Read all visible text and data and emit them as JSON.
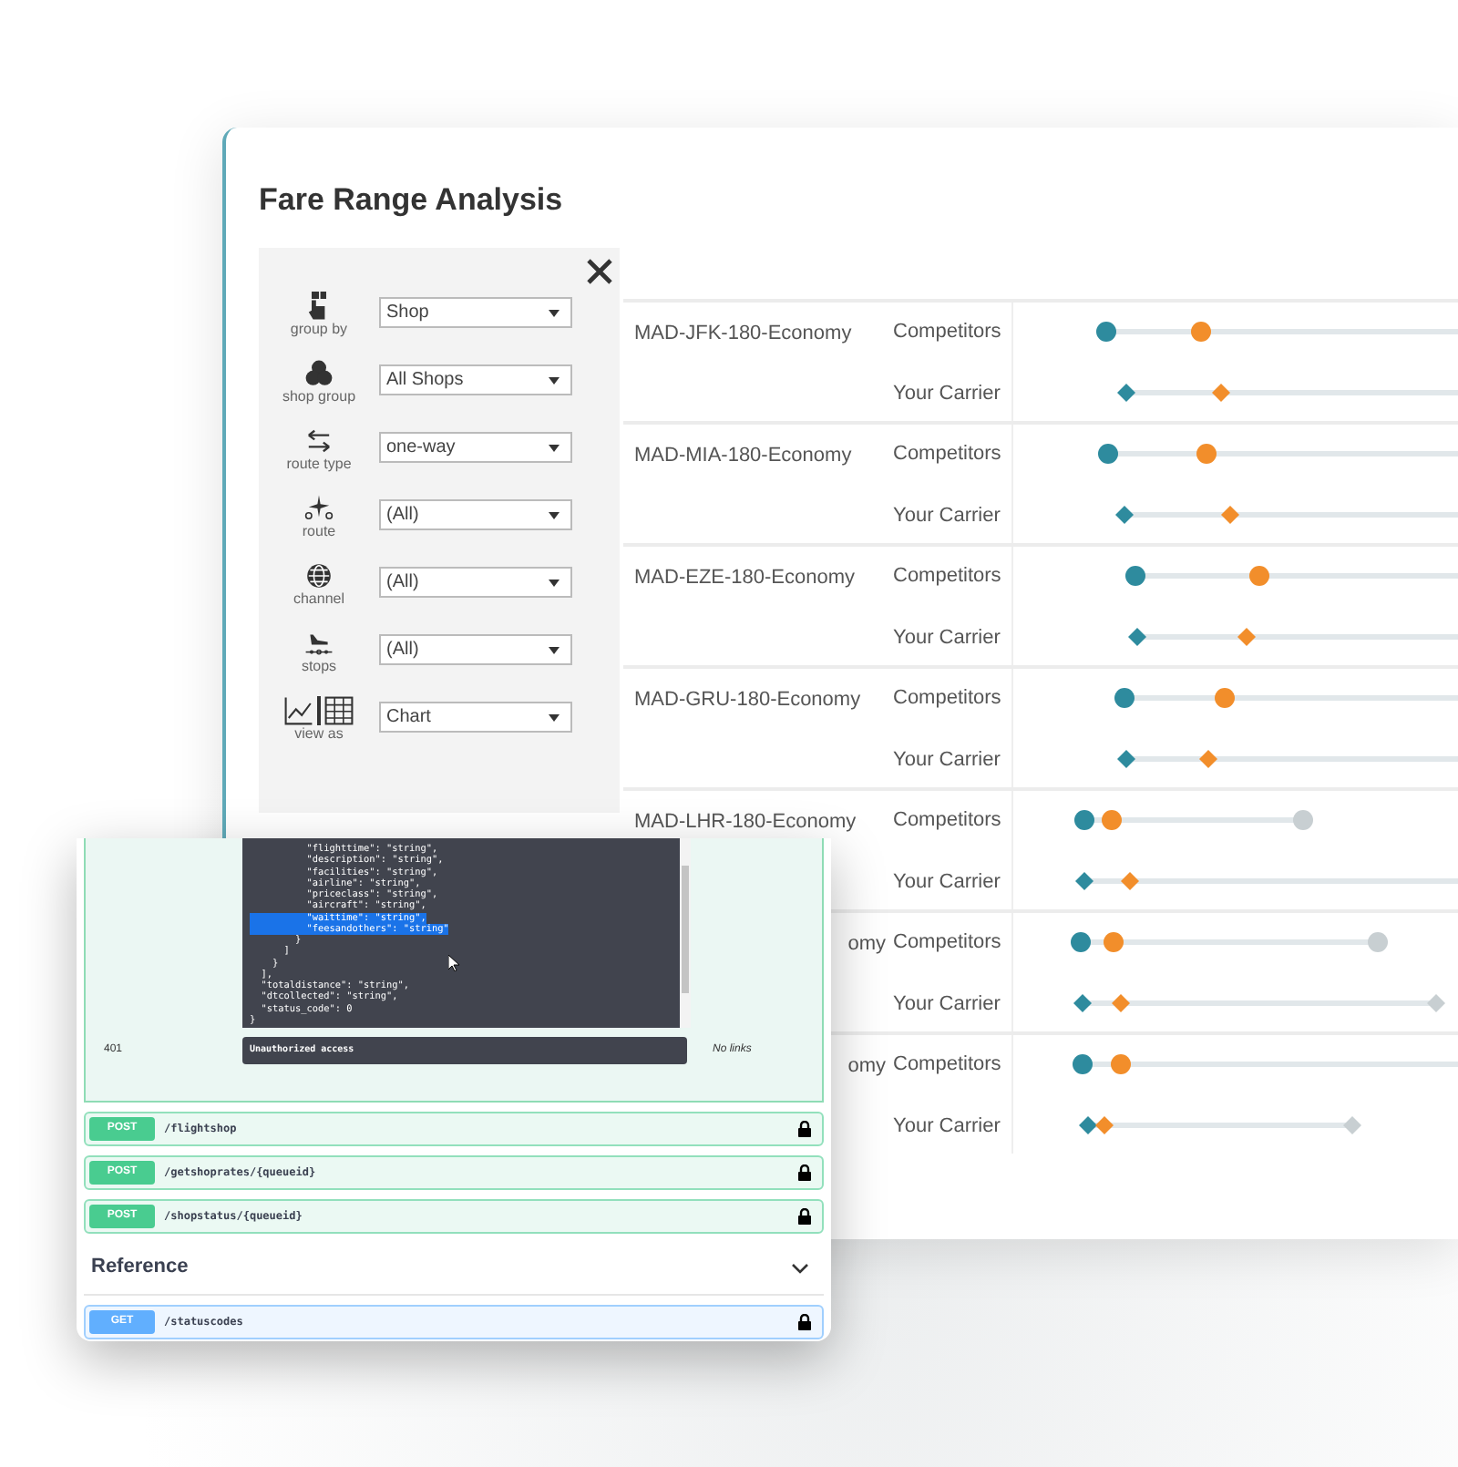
{
  "title": "Fare Range Analysis",
  "filters": [
    {
      "kind": "group",
      "label": "group by",
      "value": "Shop"
    },
    {
      "kind": "shop_group",
      "label": "shop group",
      "value": "All Shops"
    },
    {
      "kind": "route_type",
      "label": "route type",
      "value": "one-way"
    },
    {
      "kind": "route",
      "label": "route",
      "value": "(All)"
    },
    {
      "kind": "channel",
      "label": "channel",
      "value": "(All)"
    },
    {
      "kind": "stops",
      "label": "stops",
      "value": "(All)"
    },
    {
      "kind": "view",
      "label": "view as",
      "value": "Chart"
    }
  ],
  "routes": [
    {
      "label": "MAD-JFK-180-Economy",
      "cut": false,
      "series": [
        {
          "kind": "circle",
          "name": "Competitors"
        },
        {
          "kind": "diamond",
          "name": "Your Carrier"
        }
      ]
    },
    {
      "label": "MAD-MIA-180-Economy",
      "cut": false,
      "series": [
        {
          "kind": "circle",
          "name": "Competitors"
        },
        {
          "kind": "diamond",
          "name": "Your Carrier"
        }
      ]
    },
    {
      "label": "MAD-EZE-180-Economy",
      "cut": false,
      "series": [
        {
          "kind": "circle",
          "name": "Competitors"
        },
        {
          "kind": "diamond",
          "name": "Your Carrier"
        }
      ]
    },
    {
      "label": "MAD-GRU-180-Economy",
      "cut": false,
      "series": [
        {
          "kind": "circle",
          "name": "Competitors"
        },
        {
          "kind": "diamond",
          "name": "Your Carrier"
        }
      ]
    },
    {
      "label": "MAD-LHR-180-Economy",
      "cut": false,
      "series": [
        {
          "kind": "circle",
          "name": "Competitors"
        },
        {
          "kind": "diamond",
          "name": "Your Carrier"
        }
      ]
    },
    {
      "label": "omy",
      "cut": true,
      "series": [
        {
          "kind": "circle",
          "name": "Competitors"
        },
        {
          "kind": "diamond",
          "name": "Your Carrier"
        }
      ]
    },
    {
      "label": "omy",
      "cut": true,
      "series": [
        {
          "kind": "circle",
          "name": "Competitors"
        },
        {
          "kind": "diamond",
          "name": "Your Carrier"
        }
      ]
    }
  ],
  "api_panel": {
    "code_lines": [
      {
        "text": "          \"flighttime\": \"string\",",
        "selected": false
      },
      {
        "text": "          \"description\": \"string\",",
        "selected": false
      },
      {
        "text": "          \"facilities\": \"string\",",
        "selected": false
      },
      {
        "text": "          \"airline\": \"string\",",
        "selected": false
      },
      {
        "text": "          \"priceclass\": \"string\",",
        "selected": false
      },
      {
        "text": "          \"aircraft\": \"string\",",
        "selected": false
      },
      {
        "text": "          \"waittime\": \"string\",",
        "selected": true
      },
      {
        "text": "          \"feesandothers\": \"string\"",
        "selected": true
      },
      {
        "text": "        }",
        "selected": false
      },
      {
        "text": "      ]",
        "selected": false
      },
      {
        "text": "    }",
        "selected": false
      },
      {
        "text": "  ],",
        "selected": false
      },
      {
        "text": "  \"totaldistance\": \"string\",",
        "selected": false
      },
      {
        "text": "  \"dtcollected\": \"string\",",
        "selected": false
      },
      {
        "text": "  \"status_code\": 0",
        "selected": false
      },
      {
        "text": "}",
        "selected": false
      }
    ],
    "status": "401",
    "message": "Unauthorized access",
    "links": "No links",
    "endpoints": [
      {
        "method": "POST",
        "path": "/flightshop",
        "color": "#49cc90"
      },
      {
        "method": "POST",
        "path": "/getshoprates/{queueid}",
        "color": "#49cc90"
      },
      {
        "method": "POST",
        "path": "/shopstatus/{queueid}",
        "color": "#49cc90"
      }
    ],
    "section": {
      "title": "Reference",
      "expanded": true
    },
    "reference_endpoints": [
      {
        "method": "GET",
        "path": "/statuscodes",
        "color": "#61affe"
      }
    ]
  }
}
